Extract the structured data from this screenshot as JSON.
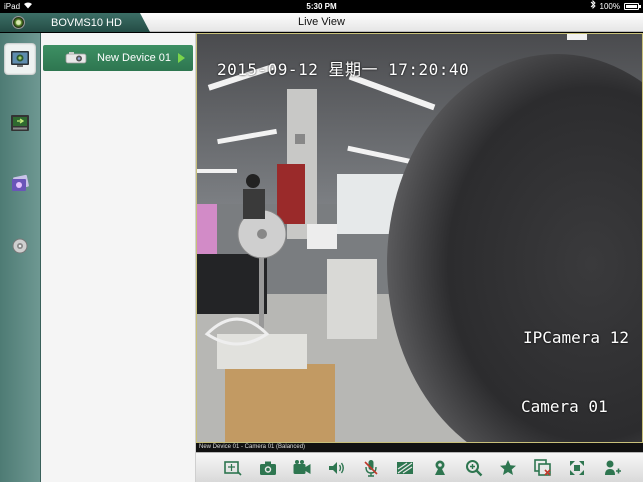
{
  "status_bar": {
    "device": "iPad",
    "time": "5:30 PM",
    "battery_text": "100%",
    "battery_level": 1.0
  },
  "header": {
    "app_title": "BOVMS10 HD",
    "page_title": "Live View"
  },
  "rail": {
    "items": [
      "live-view-icon",
      "playback-icon",
      "gallery-icon",
      "settings-icon"
    ]
  },
  "device_list": {
    "items": [
      {
        "name": "New Device 01"
      }
    ]
  },
  "video": {
    "timestamp": "2015-09-12 星期一 17:20:40",
    "osd_camera_name": "IPCamera 12",
    "osd_channel_name": "Camera 01",
    "caption": "New Device 01 - Camera 01 (Balanced)"
  },
  "toolbar": {
    "buttons": [
      "split-screen-icon",
      "snapshot-icon",
      "record-icon",
      "audio-icon",
      "talk-icon",
      "image-quality-icon",
      "ptz-icon",
      "zoom-icon",
      "favorite-icon",
      "close-window-icon",
      "fullscreen-icon",
      "device-add-icon"
    ]
  },
  "colors": {
    "accent_green": "#2e7650",
    "rail_teal": "#5a8680",
    "osd_white": "#ffffff"
  }
}
